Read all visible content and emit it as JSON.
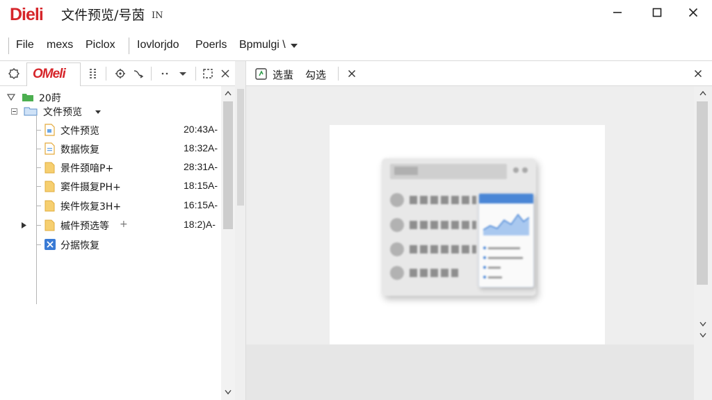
{
  "window": {
    "logo_text": "Dieli",
    "title": "文件预览/号茵",
    "lang_indicator": "IN",
    "controls": {
      "minimize": "minimize",
      "maximize": "maximize",
      "close": "close"
    }
  },
  "menu": {
    "items": [
      {
        "label": "File"
      },
      {
        "label": "mexs"
      },
      {
        "label": "Piclox"
      },
      {
        "label": "Iovlorjdo"
      },
      {
        "label": "Poerls"
      },
      {
        "label": "Bpmulgi \\"
      }
    ]
  },
  "left_toolbar": {
    "tab_label": "OMeli",
    "icons": [
      "settings-gear-icon",
      "list-icon",
      "refresh-icon",
      "more-icon",
      "chevron-down-icon",
      "pin-icon",
      "close-icon"
    ]
  },
  "tree": {
    "root": {
      "label": "20莳",
      "expanded": true
    },
    "folder": {
      "label": "文件预览",
      "expanded": true
    },
    "items": [
      {
        "label": "文件预览",
        "time": "20:43A",
        "icon": "document-icon"
      },
      {
        "label": "数据恢复",
        "time": "18:32A",
        "icon": "document-icon"
      },
      {
        "label": "景件颈喑P+",
        "time": "28:31A",
        "icon": "folder-icon"
      },
      {
        "label": "窦件摄复PH+",
        "time": "18:15A",
        "icon": "folder-icon"
      },
      {
        "label": "挨件恢复3H+",
        "time": "16:15A",
        "icon": "folder-icon"
      },
      {
        "label": "槭件预选等",
        "suffix": "+",
        "time": "18:2)A",
        "icon": "folder-icon",
        "collapsed_arrow": true
      },
      {
        "label": "分据恢复",
        "time": "",
        "icon": "app-icon"
      }
    ],
    "time_suffix": "-"
  },
  "right_toolbar": {
    "preview_label": "选蜚",
    "select_label": "勾选"
  },
  "colors": {
    "brand_red": "#d6262b",
    "folder_yellow": "#f6cf70",
    "folder_green": "#4caf50",
    "folder_blue": "#7ab0e8",
    "accent_blue": "#4a86d6"
  }
}
